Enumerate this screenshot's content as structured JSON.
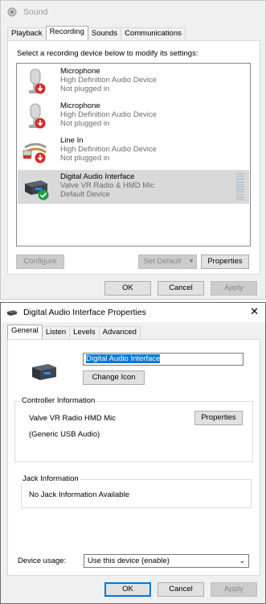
{
  "sound": {
    "title": "Sound",
    "tabs": [
      "Playback",
      "Recording",
      "Sounds",
      "Communications"
    ],
    "active_tab": "Recording",
    "instruction": "Select a recording device below to modify its settings:",
    "devices": [
      {
        "name": "Microphone",
        "driver": "High Definition Audio Device",
        "status": "Not plugged in",
        "icon": "microphone-icon",
        "badge": "unplugged-badge-icon"
      },
      {
        "name": "Microphone",
        "driver": "High Definition Audio Device",
        "status": "Not plugged in",
        "icon": "microphone-icon",
        "badge": "unplugged-badge-icon"
      },
      {
        "name": "Line In",
        "driver": "High Definition Audio Device",
        "status": "Not plugged in",
        "icon": "line-in-cable-icon",
        "badge": "unplugged-badge-icon"
      },
      {
        "name": "Digital Audio Interface",
        "driver": "Valve VR Radio & HMD Mic",
        "status": "Default Device",
        "icon": "audio-interface-icon",
        "badge": "default-check-icon",
        "selected": true
      }
    ],
    "buttons": {
      "configure": "Configure",
      "set_default": "Set Default",
      "properties": "Properties",
      "ok": "OK",
      "cancel": "Cancel",
      "apply": "Apply"
    }
  },
  "props": {
    "title": "Digital Audio Interface Properties",
    "tabs": [
      "General",
      "Listen",
      "Levels",
      "Advanced"
    ],
    "active_tab": "General",
    "device_name": "Digital Audio Interface",
    "change_icon": "Change Icon",
    "controller_label": "Controller Information",
    "controller_name": "Valve VR Radio  HMD Mic",
    "controller_properties": "Properties",
    "controller_driver": "(Generic USB Audio)",
    "jack_label": "Jack Information",
    "jack_text": "No Jack Information Available",
    "device_usage_label": "Device usage:",
    "device_usage_value": "Use this device (enable)",
    "buttons": {
      "ok": "OK",
      "cancel": "Cancel",
      "apply": "Apply"
    }
  },
  "colors": {
    "accent": "#0078d7",
    "selected_row": "#d9d9d9",
    "badge_red": "#d42a2a",
    "badge_green": "#1e9e3e"
  }
}
